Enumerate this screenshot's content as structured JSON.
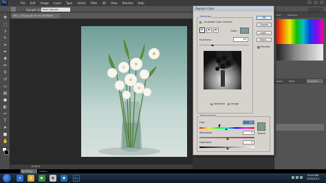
{
  "app": {
    "logo": "Ps",
    "menu": [
      "File",
      "Edit",
      "Image",
      "Layer",
      "Type",
      "Select",
      "Filter",
      "3D",
      "View",
      "Window",
      "Help"
    ]
  },
  "options_bar": {
    "sample_size_label": "Sample Size:",
    "sample_size_value": "Point Sample"
  },
  "document": {
    "tab_title": "IMG_1234.jpg @ 16.7% (RGB/8#)",
    "zoom": "16.67%",
    "bottom_tabs": [
      "Mini Bridge",
      "Timeline"
    ]
  },
  "dialog": {
    "title": "Replace Color",
    "selection_group": "Selection",
    "localized_clusters_label": "Localized Color Clusters",
    "color_label": "Color:",
    "fuzziness_label": "Fuzziness:",
    "fuzziness_value": "40",
    "selection_radio": "Selection",
    "image_radio": "Image",
    "replacement_group": "Replacement",
    "hue_label": "Hue:",
    "hue_value": "-10",
    "saturation_label": "Saturation:",
    "saturation_value": "0",
    "lightness_label": "Lightness:",
    "lightness_value": "0",
    "result_label": "Result",
    "buttons": {
      "ok": "OK",
      "cancel": "Cancel",
      "load": "Load...",
      "save": "Save..."
    },
    "preview_label": "Preview",
    "preview_checked": true,
    "selected_color": "#7d98a0",
    "result_color": "#7d9d8c"
  },
  "panels": {
    "color_tabs": [
      "Color",
      "Swatches"
    ],
    "layers_tabs": [
      "Layers",
      "Paths",
      "Properties"
    ]
  },
  "taskbar": {
    "time": "12:45 AM",
    "date": "1/25/2013"
  }
}
